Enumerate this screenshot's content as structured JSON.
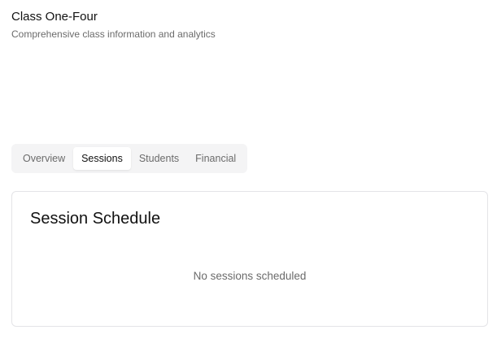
{
  "header": {
    "title": "Class One-Four",
    "subtitle": "Comprehensive class information and analytics"
  },
  "tabs": [
    {
      "label": "Overview",
      "active": false
    },
    {
      "label": "Sessions",
      "active": true
    },
    {
      "label": "Students",
      "active": false
    },
    {
      "label": "Financial",
      "active": false
    }
  ],
  "session_card": {
    "title": "Session Schedule",
    "empty_message": "No sessions scheduled"
  }
}
